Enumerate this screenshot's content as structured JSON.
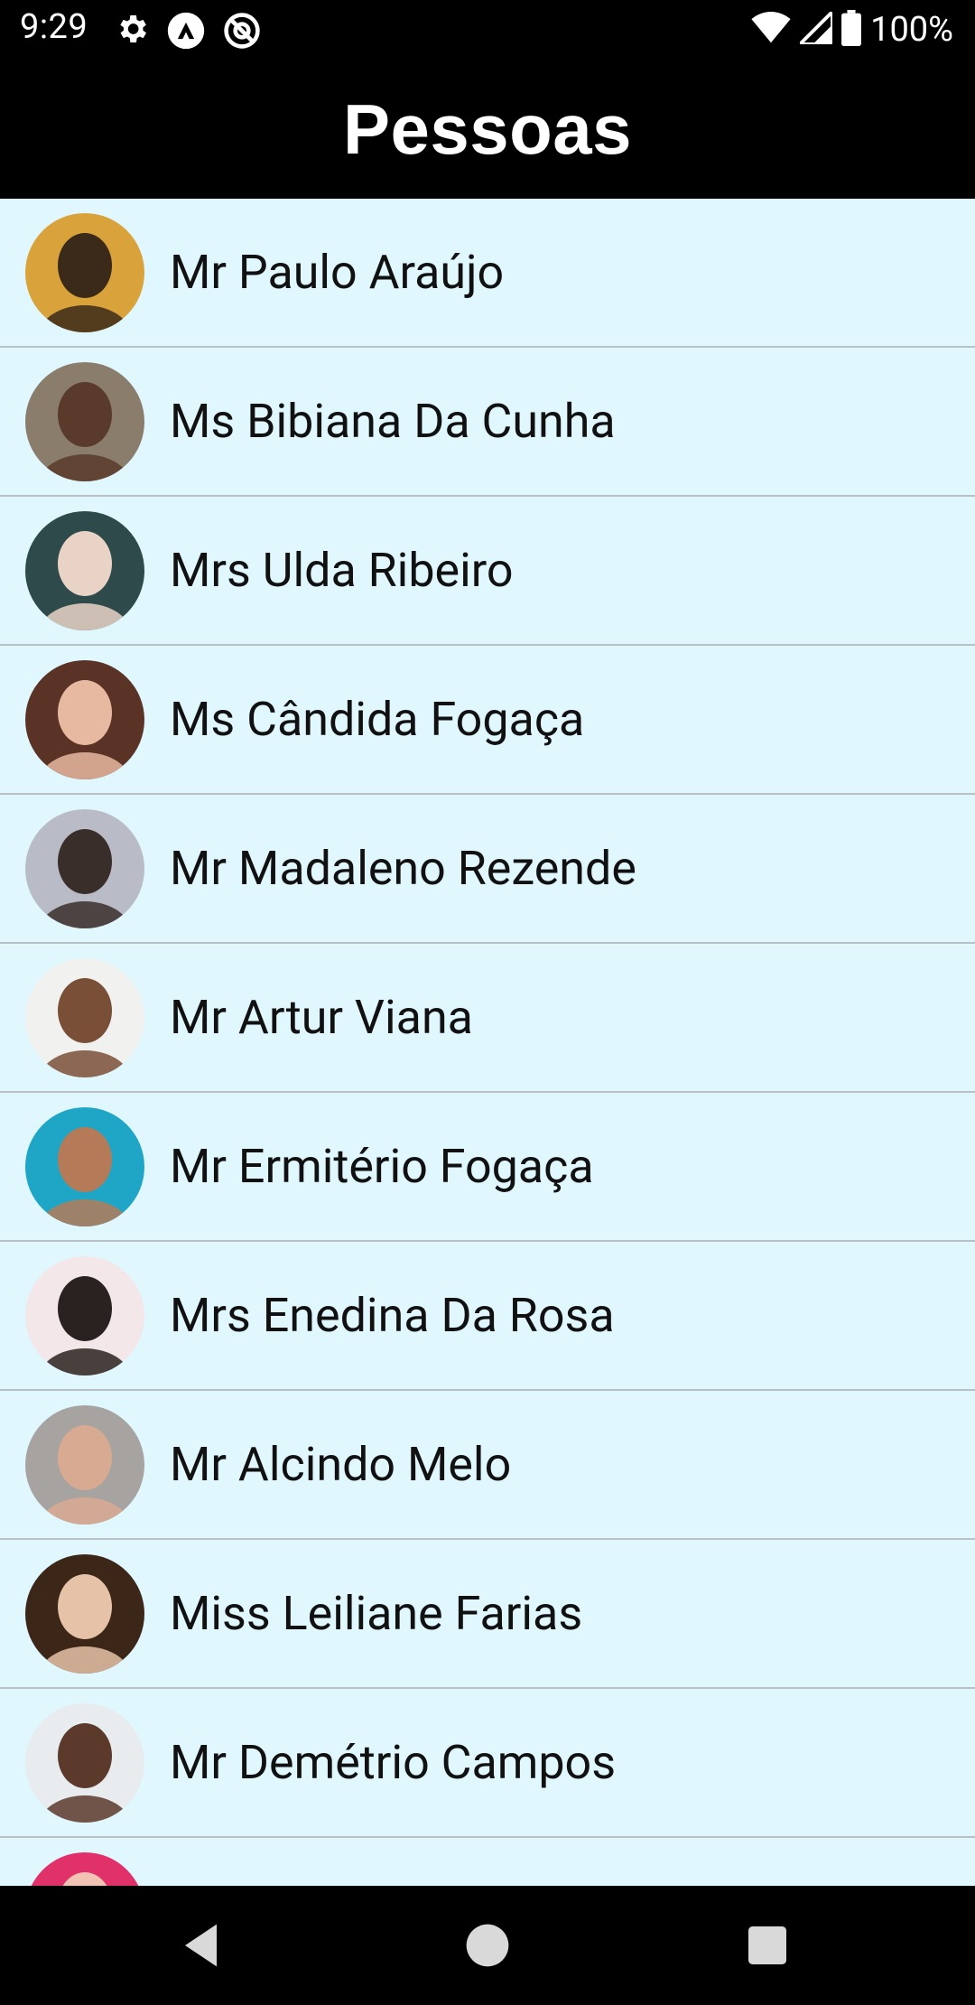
{
  "status_bar": {
    "time": "9:29",
    "battery": "100%",
    "icons": [
      "settings-icon",
      "app-a-icon",
      "no-tracking-icon",
      "wifi-icon",
      "signal-icon",
      "battery-icon"
    ]
  },
  "app_bar": {
    "title": "Pessoas"
  },
  "people": [
    {
      "name": "Mr Paulo Araújo",
      "avatar_bg": "#d9a23a",
      "avatar_fg": "#3b2a1a"
    },
    {
      "name": "Ms Bibiana Da Cunha",
      "avatar_bg": "#8a7d6b",
      "avatar_fg": "#5a3a2a"
    },
    {
      "name": "Mrs Ulda Ribeiro",
      "avatar_bg": "#2f4a4a",
      "avatar_fg": "#e9d3c6"
    },
    {
      "name": "Ms Cândida Fogaça",
      "avatar_bg": "#5a3326",
      "avatar_fg": "#e7b9a1"
    },
    {
      "name": "Mr Madaleno Rezende",
      "avatar_bg": "#b9bcc6",
      "avatar_fg": "#3a2e2b"
    },
    {
      "name": "Mr Artur Viana",
      "avatar_bg": "#f1f1ef",
      "avatar_fg": "#7a4f37"
    },
    {
      "name": "Mr Ermitério Fogaça",
      "avatar_bg": "#1fa6c7",
      "avatar_fg": "#b57a58"
    },
    {
      "name": "Mrs Enedina Da Rosa",
      "avatar_bg": "#f3e7ea",
      "avatar_fg": "#2a2220"
    },
    {
      "name": "Mr Alcindo Melo",
      "avatar_bg": "#a6a3a0",
      "avatar_fg": "#d9aa92"
    },
    {
      "name": "Miss Leiliane Farias",
      "avatar_bg": "#3b2618",
      "avatar_fg": "#e6c3a8"
    },
    {
      "name": "Mr Demétrio Campos",
      "avatar_bg": "#e8ecef",
      "avatar_fg": "#5b3a2b"
    },
    {
      "name": "",
      "avatar_bg": "#e0316a",
      "avatar_fg": "#f2c2b5"
    }
  ],
  "nav_bar": {
    "icons": [
      "back-icon",
      "home-icon",
      "recents-icon"
    ]
  },
  "colors": {
    "list_background": "#e0f7fe",
    "divider": "#b9c1c4",
    "app_bar": "#000000"
  }
}
